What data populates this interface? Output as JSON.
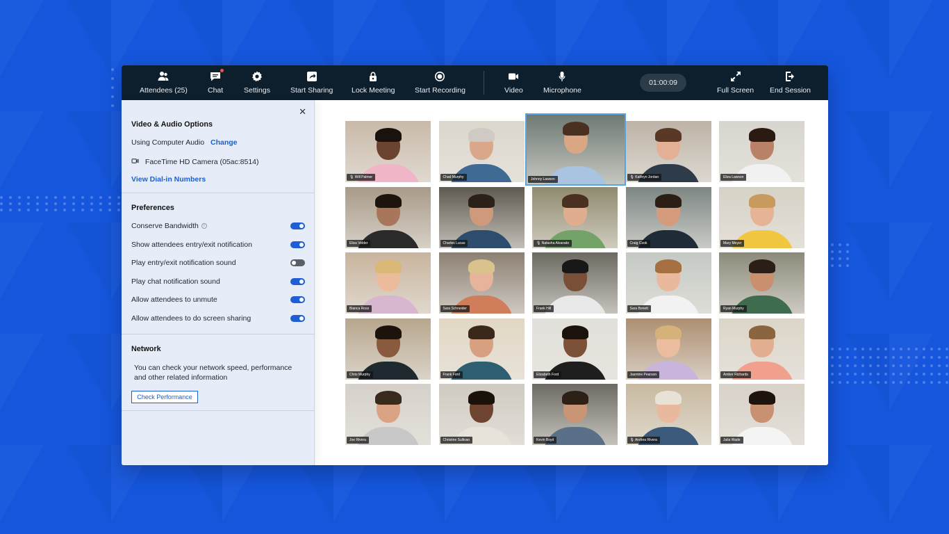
{
  "toolbar": {
    "attendees_label": "Attendees (25)",
    "chat_label": "Chat",
    "settings_label": "Settings",
    "start_sharing_label": "Start Sharing",
    "lock_meeting_label": "Lock Meeting",
    "start_recording_label": "Start Recording",
    "video_label": "Video",
    "microphone_label": "Microphone",
    "timer": "01:00:09",
    "full_screen_label": "Full Screen",
    "end_session_label": "End Session"
  },
  "panel": {
    "video_audio_title": "Video & Audio Options",
    "computer_audio": "Using Computer Audio",
    "change_link": "Change",
    "camera": "FaceTime HD Camera (05ac:8514)",
    "dial_in_link": "View Dial-in Numbers",
    "preferences_title": "Preferences",
    "preferences": [
      {
        "label": "Conserve Bandwidth",
        "on": true
      },
      {
        "label": "Show attendees entry/exit notification",
        "on": true
      },
      {
        "label": "Play entry/exit notification sound",
        "on": false
      },
      {
        "label": "Play chat notification sound",
        "on": true
      },
      {
        "label": "Allow attendees to unmute",
        "on": true
      },
      {
        "label": "Allow attendees to do screen sharing",
        "on": true
      }
    ],
    "network_title": "Network",
    "network_desc_line1": "You can check your network speed, performance",
    "network_desc_line2": "and other related information",
    "check_button": "Check Performance"
  },
  "participants": [
    {
      "name": "Will Palmer",
      "skin": "#6b4430",
      "hair": "#1a120c",
      "shirt": "#f0b6c8",
      "bg": "#c9b9a8",
      "mic_icon": true
    },
    {
      "name": "Chad Murphy",
      "skin": "#d9a88a",
      "hair": "#cfcac4",
      "shirt": "#3e6a93",
      "bg": "#dcd7cc",
      "mic_icon": false
    },
    {
      "name": "Johnny Lawson",
      "skin": "#d9a784",
      "hair": "#4a3020",
      "shirt": "#a8c4e0",
      "bg": "#6d7a72",
      "mic_icon": false
    },
    {
      "name": "Kathryn Jordan",
      "skin": "#e3b095",
      "hair": "#5a3826",
      "shirt": "#2e3b48",
      "bg": "#bdb3a6",
      "mic_icon": true
    },
    {
      "name": "Eliza Lawson",
      "skin": "#b98268",
      "hair": "#2b1a12",
      "shirt": "#f1f1f1",
      "bg": "#d8d5cf",
      "mic_icon": false
    },
    {
      "name": "Eliza Velder",
      "skin": "#a8765a",
      "hair": "#1d140e",
      "shirt": "#2a2a2a",
      "bg": "#a89a88",
      "mic_icon": false
    },
    {
      "name": "Charles Lucas",
      "skin": "#cf9a7c",
      "hair": "#2c2119",
      "shirt": "#2d4c6e",
      "bg": "#5e5a50",
      "mic_icon": false
    },
    {
      "name": "Natasha Alvarado",
      "skin": "#e0ad8f",
      "hair": "#4a3020",
      "shirt": "#74a36a",
      "bg": "#8f8a6e",
      "mic_icon": true
    },
    {
      "name": "Craig Cook",
      "skin": "#d49c7c",
      "hair": "#2b1e15",
      "shirt": "#1f2b36",
      "bg": "#7d8683",
      "mic_icon": false
    },
    {
      "name": "Mary Meyer",
      "skin": "#e5b396",
      "hair": "#c89a5e",
      "shirt": "#f1c640",
      "bg": "#d7d2c6",
      "mic_icon": false
    },
    {
      "name": "Bianca Ross",
      "skin": "#ebbb9c",
      "hair": "#d9b878",
      "shirt": "#d7b7cf",
      "bg": "#c9b49e",
      "mic_icon": false
    },
    {
      "name": "Sara Schneider",
      "skin": "#e6b49a",
      "hair": "#d9c28c",
      "shirt": "#cf7d5a",
      "bg": "#8c8072",
      "mic_icon": false
    },
    {
      "name": "Frank Hill",
      "skin": "#7a4f38",
      "hair": "#181818",
      "shirt": "#e8e8e8",
      "bg": "#6b6960",
      "mic_icon": false
    },
    {
      "name": "Sara Bonett",
      "skin": "#e8b99b",
      "hair": "#a66f42",
      "shirt": "#f2f2f2",
      "bg": "#c4c9c4",
      "mic_icon": false
    },
    {
      "name": "Ryan Murphy",
      "skin": "#c8906e",
      "hair": "#2a1e16",
      "shirt": "#3f6b4f",
      "bg": "#8b8a7a",
      "mic_icon": false
    },
    {
      "name": "Chris Murphy",
      "skin": "#8a5a3e",
      "hair": "#1c130d",
      "shirt": "#1f2a30",
      "bg": "#b7a68e",
      "mic_icon": false
    },
    {
      "name": "Frank Ford",
      "skin": "#d6a081",
      "hair": "#3a281b",
      "shirt": "#2e5e72",
      "bg": "#e2d7c4",
      "mic_icon": false
    },
    {
      "name": "Elizabeth Ford",
      "skin": "#7d5138",
      "hair": "#1b120c",
      "shirt": "#1e1e1e",
      "bg": "#e2e0da",
      "mic_icon": false
    },
    {
      "name": "Jasmine Pearson",
      "skin": "#ebbc9e",
      "hair": "#d5b27a",
      "shirt": "#c9b4dc",
      "bg": "#ad8f72",
      "mic_icon": false
    },
    {
      "name": "Amber Richards",
      "skin": "#e2ae90",
      "hair": "#8b6440",
      "shirt": "#f0a08c",
      "bg": "#dcd5c8",
      "mic_icon": false
    },
    {
      "name": "Joe Rivera",
      "skin": "#d9a384",
      "hair": "#3a2a1e",
      "shirt": "#c7c7c7",
      "bg": "#d5d1ca",
      "mic_icon": false
    },
    {
      "name": "Christine Sullivan",
      "skin": "#6e4330",
      "hair": "#1a110b",
      "shirt": "#e8e3da",
      "bg": "#cfcbc2",
      "mic_icon": false
    },
    {
      "name": "Kevin Boyd",
      "skin": "#c99574",
      "hair": "#2c2017",
      "shirt": "#5a6f88",
      "bg": "#6c6a62",
      "mic_icon": false
    },
    {
      "name": "Andrea Rivera",
      "skin": "#e9b99d",
      "hair": "#e8e2d6",
      "shirt": "#3c5a7c",
      "bg": "#c9b99f",
      "mic_icon": true
    },
    {
      "name": "Julia Wade",
      "skin": "#c99072",
      "hair": "#1e140e",
      "shirt": "#f4f4f4",
      "bg": "#d8d2c7",
      "mic_icon": false
    }
  ]
}
